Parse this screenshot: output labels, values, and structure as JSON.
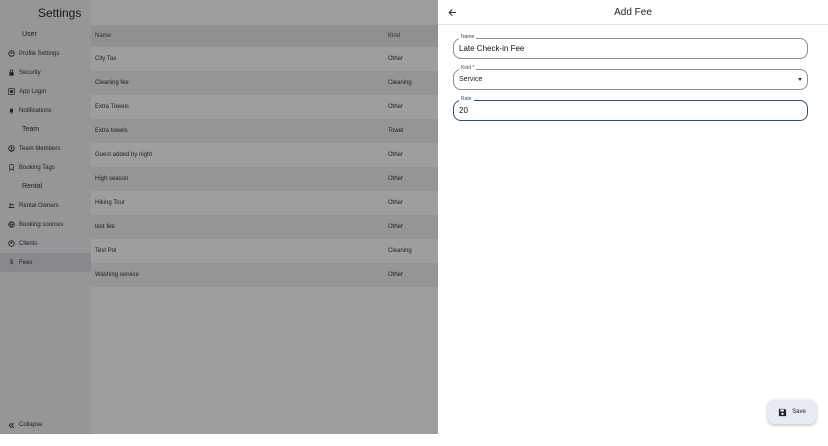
{
  "sidebar": {
    "title": "Settings",
    "groups": [
      {
        "label": "User",
        "items": [
          {
            "icon": "profile-icon",
            "label": "Profile Settings"
          },
          {
            "icon": "lock-icon",
            "label": "Security"
          },
          {
            "icon": "app-login-icon",
            "label": "App Login"
          },
          {
            "icon": "bell-icon",
            "label": "Notifications"
          }
        ]
      },
      {
        "label": "Team",
        "items": [
          {
            "icon": "team-icon",
            "label": "Team Members"
          },
          {
            "icon": "bookmark-icon",
            "label": "Booking Tags"
          }
        ]
      },
      {
        "label": "Rental",
        "items": [
          {
            "icon": "owners-icon",
            "label": "Rental Owners"
          },
          {
            "icon": "sources-icon",
            "label": "Booking sources"
          },
          {
            "icon": "clients-icon",
            "label": "Clients"
          },
          {
            "icon": "dollar-icon",
            "label": "Fees",
            "active": true
          }
        ]
      }
    ],
    "collapse_label": "Collapse"
  },
  "table": {
    "columns": [
      "Name",
      "Kind"
    ],
    "rows": [
      {
        "name": "City Tax",
        "kind": "Other"
      },
      {
        "name": "Cleaning fee",
        "kind": "Cleaning"
      },
      {
        "name": "Extra Towels",
        "kind": "Other"
      },
      {
        "name": "Extra towels",
        "kind": "Towel"
      },
      {
        "name": "Guest added by night",
        "kind": "Other"
      },
      {
        "name": "High season",
        "kind": "Other"
      },
      {
        "name": "Hiking Tour",
        "kind": "Other"
      },
      {
        "name": "test fee",
        "kind": "Other"
      },
      {
        "name": "Test Pol",
        "kind": "Cleaning"
      },
      {
        "name": "Washing service",
        "kind": "Other"
      }
    ]
  },
  "panel": {
    "title": "Add Fee",
    "name_field": {
      "label": "Name",
      "value": "Late Check-in Fee"
    },
    "kind_field": {
      "label": "Kind *",
      "value": "Service"
    },
    "rate_field": {
      "label": "Rate",
      "value": "20"
    },
    "save_label": "Save"
  },
  "colors": {
    "accent": "#2f4e7b",
    "scrim": "rgba(0,0,0,0.38)",
    "save_button_bg": "#e6ebf4"
  }
}
